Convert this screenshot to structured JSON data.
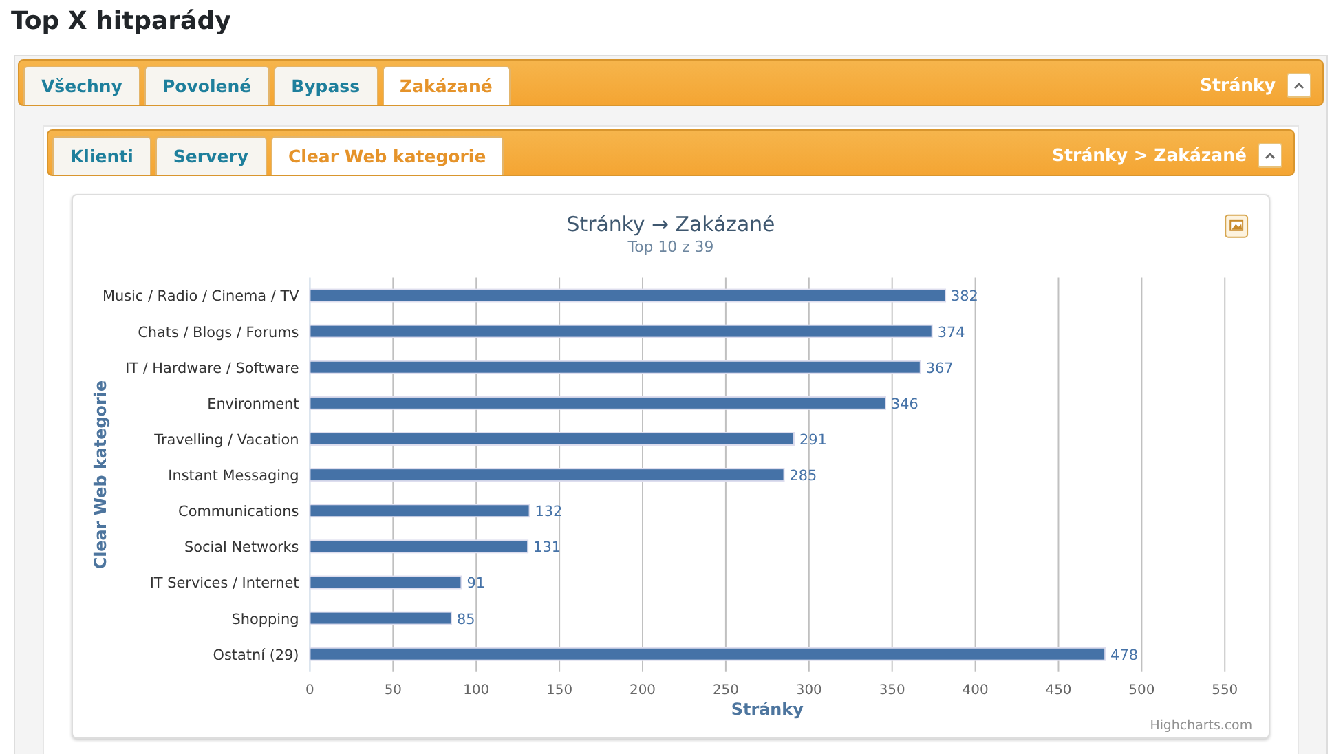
{
  "page_title": "Top X hitparády",
  "main_panel": {
    "tabs": [
      {
        "label": "Všechny",
        "selected": false
      },
      {
        "label": "Povolené",
        "selected": false
      },
      {
        "label": "Bypass",
        "selected": false
      },
      {
        "label": "Zakázané",
        "selected": true
      }
    ],
    "header_text": "Stránky"
  },
  "sub_panel": {
    "tabs": [
      {
        "label": "Klienti",
        "selected": false
      },
      {
        "label": "Servery",
        "selected": false
      },
      {
        "label": "Clear Web kategorie",
        "selected": true
      }
    ],
    "header_text": "Stránky > Zakázané"
  },
  "chart_credit": "Highcharts.com",
  "chart_data": {
    "type": "bar",
    "orientation": "horizontal",
    "title": "Stránky → Zakázané",
    "subtitle": "Top 10 z 39",
    "xlabel": "Stránky",
    "ylabel": "Clear Web kategorie",
    "categories": [
      "Music / Radio / Cinema / TV",
      "Chats / Blogs / Forums",
      "IT / Hardware / Software",
      "Environment",
      "Travelling / Vacation",
      "Instant Messaging",
      "Communications",
      "Social Networks",
      "IT Services / Internet",
      "Shopping",
      "Ostatní (29)"
    ],
    "series": [
      {
        "color": "#4572a7",
        "values": [
          382,
          374,
          367,
          346,
          291,
          285,
          132,
          131,
          91,
          85,
          478
        ]
      }
    ],
    "xlim": [
      0,
      550
    ],
    "xticks": [
      0,
      50,
      100,
      150,
      200,
      250,
      300,
      350,
      400,
      450,
      500,
      550
    ],
    "data_labels": true,
    "grid": true
  }
}
